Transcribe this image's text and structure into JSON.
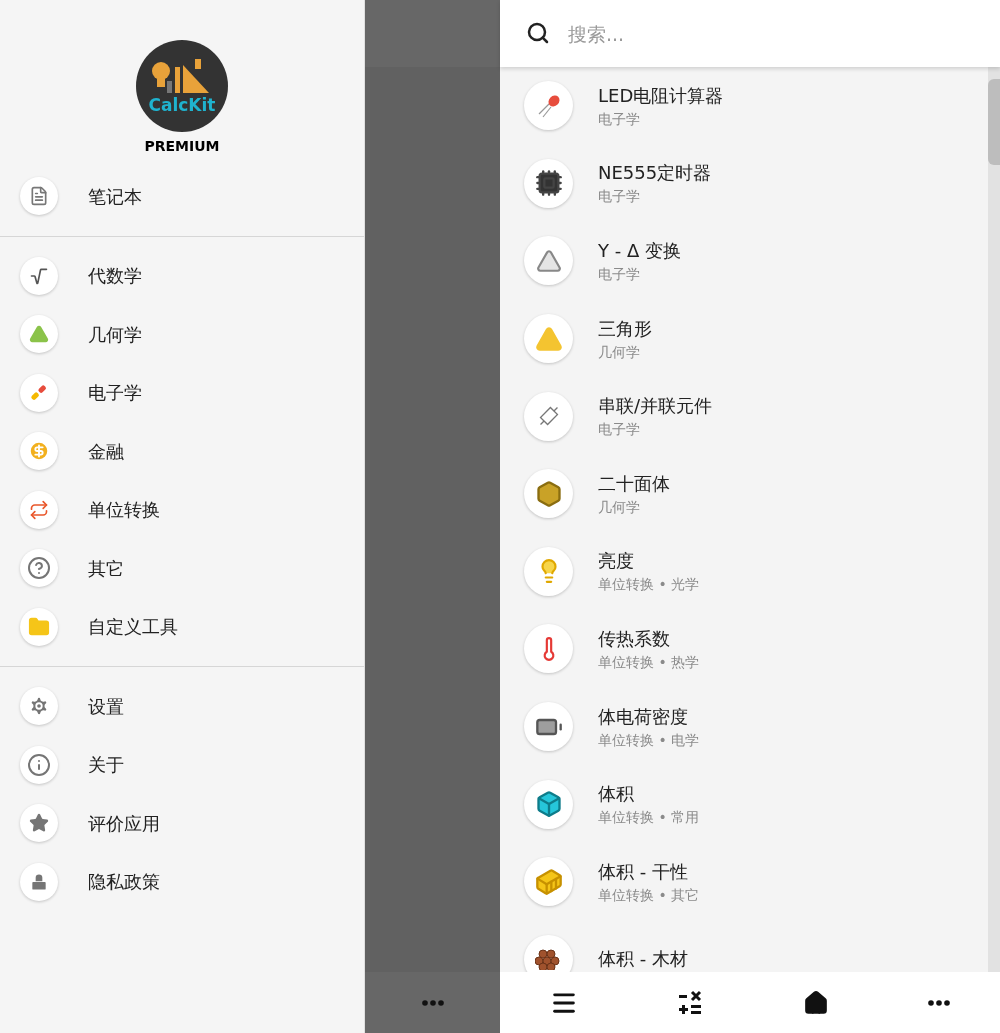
{
  "drawer": {
    "logo_text": "CalcKit",
    "badge": "PREMIUM",
    "sections": [
      {
        "items": [
          {
            "label": "笔记本"
          }
        ]
      },
      {
        "items": [
          {
            "label": "代数学"
          },
          {
            "label": "几何学"
          },
          {
            "label": "电子学"
          },
          {
            "label": "金融"
          },
          {
            "label": "单位转换"
          },
          {
            "label": "其它"
          },
          {
            "label": "自定义工具"
          }
        ]
      },
      {
        "items": [
          {
            "label": "设置"
          },
          {
            "label": "关于"
          },
          {
            "label": "评价应用"
          },
          {
            "label": "隐私政策"
          }
        ]
      }
    ]
  },
  "search": {
    "placeholder": "搜索..."
  },
  "tools": [
    {
      "title": "LED电阻计算器",
      "subtitle": "电子学"
    },
    {
      "title": "NE555定时器",
      "subtitle": "电子学"
    },
    {
      "title": "Y - Δ 变换",
      "subtitle": "电子学"
    },
    {
      "title": "三角形",
      "subtitle": "几何学"
    },
    {
      "title": "串联/并联元件",
      "subtitle": "电子学"
    },
    {
      "title": "二十面体",
      "subtitle": "几何学"
    },
    {
      "title": "亮度",
      "subtitle": "单位转换 • 光学"
    },
    {
      "title": "传热系数",
      "subtitle": "单位转换 • 热学"
    },
    {
      "title": "体电荷密度",
      "subtitle": "单位转换 • 电学"
    },
    {
      "title": "体积",
      "subtitle": "单位转换 • 常用"
    },
    {
      "title": "体积 - 干性",
      "subtitle": "单位转换 • 其它"
    },
    {
      "title": "体积 - 木材"
    }
  ]
}
